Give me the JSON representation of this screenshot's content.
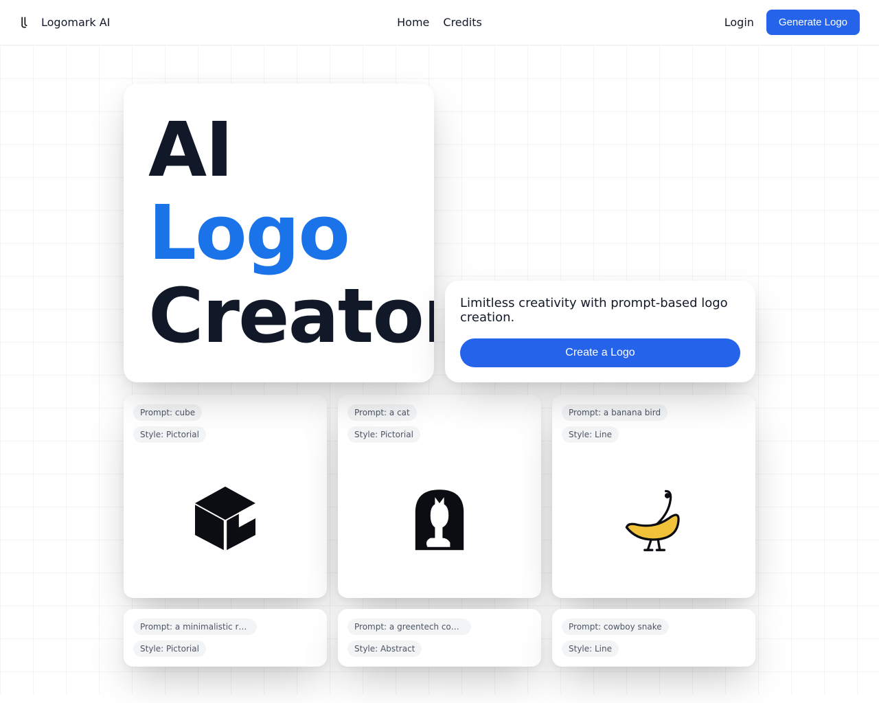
{
  "header": {
    "brand": "Logomark AI",
    "nav": {
      "home": "Home",
      "credits": "Credits"
    },
    "login": "Login",
    "generate": "Generate Logo"
  },
  "hero": {
    "line1": "AI",
    "line2": "Logo",
    "line3": "Creator",
    "subtitle": "Limitless creativity with prompt-based logo creation.",
    "cta": "Create a Logo"
  },
  "cards": [
    {
      "prompt": "Prompt: cube",
      "style": "Style: Pictorial"
    },
    {
      "prompt": "Prompt: a cat",
      "style": "Style: Pictorial"
    },
    {
      "prompt": "Prompt: a banana bird",
      "style": "Style: Line"
    },
    {
      "prompt": "Prompt: a minimalistic rainforest ...",
      "style": "Style: Pictorial"
    },
    {
      "prompt": "Prompt: a greentech company",
      "style": "Style: Abstract"
    },
    {
      "prompt": "Prompt: cowboy snake",
      "style": "Style: Line"
    }
  ]
}
